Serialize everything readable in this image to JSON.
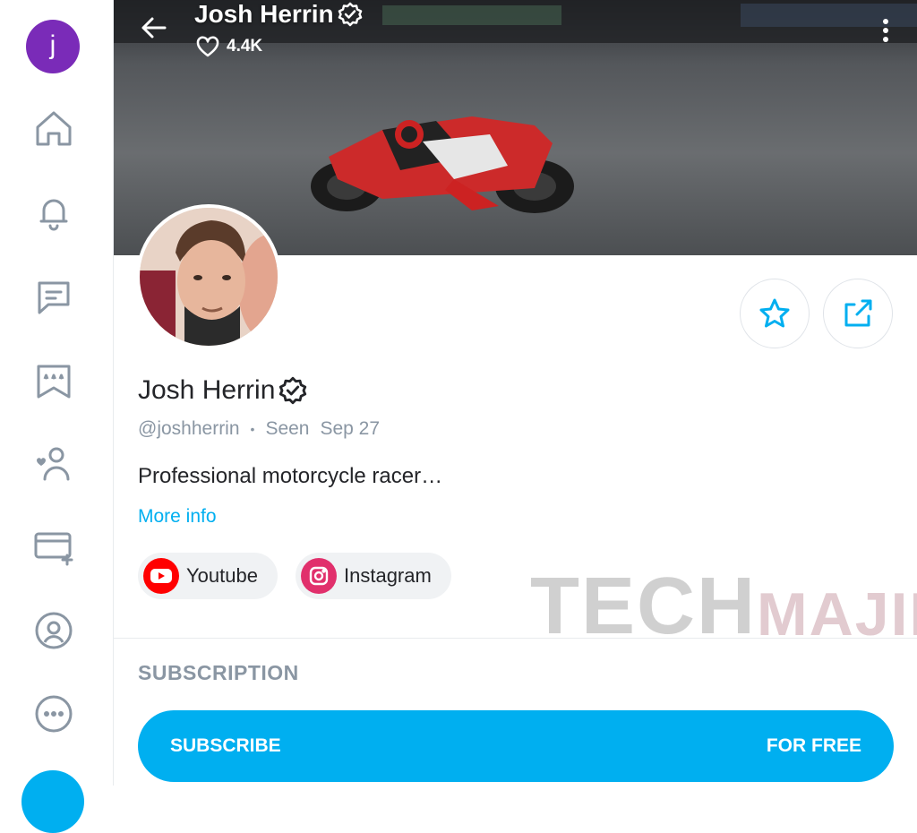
{
  "user_avatar": {
    "initial": "j",
    "color": "#7a2bb8"
  },
  "sidebar": {
    "items": [
      {
        "name": "home-icon"
      },
      {
        "name": "bell-icon"
      },
      {
        "name": "message-icon"
      },
      {
        "name": "collections-icon"
      },
      {
        "name": "subscriptions-icon"
      },
      {
        "name": "add-card-icon"
      },
      {
        "name": "my-profile-icon"
      },
      {
        "name": "more-options-icon"
      }
    ]
  },
  "header": {
    "name": "Josh Herrin",
    "likes": "4.4K"
  },
  "profile": {
    "name": "Josh Herrin",
    "handle": "@joshherrin",
    "seen_label": "Seen",
    "seen_date": "Sep 27",
    "bio": "Professional motorcycle racer…",
    "more_info": "More info"
  },
  "socials": [
    {
      "label": "Youtube",
      "color": "#ff0000"
    },
    {
      "label": "Instagram",
      "color": "#e1306c"
    }
  ],
  "watermark": {
    "big": "TECH",
    "small": "MAJIN"
  },
  "subscription": {
    "title": "SUBSCRIPTION",
    "button_label": "SUBSCRIBE",
    "price": "FOR FREE"
  },
  "colors": {
    "accent": "#00aff0",
    "muted": "#8a96a3"
  }
}
